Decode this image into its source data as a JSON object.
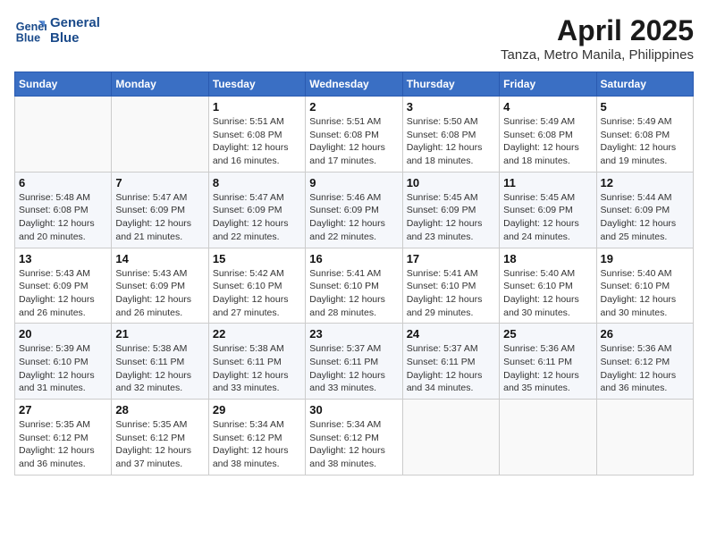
{
  "header": {
    "logo_line1": "General",
    "logo_line2": "Blue",
    "month_title": "April 2025",
    "location": "Tanza, Metro Manila, Philippines"
  },
  "weekdays": [
    "Sunday",
    "Monday",
    "Tuesday",
    "Wednesday",
    "Thursday",
    "Friday",
    "Saturday"
  ],
  "weeks": [
    [
      {
        "day": "",
        "sunrise": "",
        "sunset": "",
        "daylight": ""
      },
      {
        "day": "",
        "sunrise": "",
        "sunset": "",
        "daylight": ""
      },
      {
        "day": "1",
        "sunrise": "Sunrise: 5:51 AM",
        "sunset": "Sunset: 6:08 PM",
        "daylight": "Daylight: 12 hours and 16 minutes."
      },
      {
        "day": "2",
        "sunrise": "Sunrise: 5:51 AM",
        "sunset": "Sunset: 6:08 PM",
        "daylight": "Daylight: 12 hours and 17 minutes."
      },
      {
        "day": "3",
        "sunrise": "Sunrise: 5:50 AM",
        "sunset": "Sunset: 6:08 PM",
        "daylight": "Daylight: 12 hours and 18 minutes."
      },
      {
        "day": "4",
        "sunrise": "Sunrise: 5:49 AM",
        "sunset": "Sunset: 6:08 PM",
        "daylight": "Daylight: 12 hours and 18 minutes."
      },
      {
        "day": "5",
        "sunrise": "Sunrise: 5:49 AM",
        "sunset": "Sunset: 6:08 PM",
        "daylight": "Daylight: 12 hours and 19 minutes."
      }
    ],
    [
      {
        "day": "6",
        "sunrise": "Sunrise: 5:48 AM",
        "sunset": "Sunset: 6:08 PM",
        "daylight": "Daylight: 12 hours and 20 minutes."
      },
      {
        "day": "7",
        "sunrise": "Sunrise: 5:47 AM",
        "sunset": "Sunset: 6:09 PM",
        "daylight": "Daylight: 12 hours and 21 minutes."
      },
      {
        "day": "8",
        "sunrise": "Sunrise: 5:47 AM",
        "sunset": "Sunset: 6:09 PM",
        "daylight": "Daylight: 12 hours and 22 minutes."
      },
      {
        "day": "9",
        "sunrise": "Sunrise: 5:46 AM",
        "sunset": "Sunset: 6:09 PM",
        "daylight": "Daylight: 12 hours and 22 minutes."
      },
      {
        "day": "10",
        "sunrise": "Sunrise: 5:45 AM",
        "sunset": "Sunset: 6:09 PM",
        "daylight": "Daylight: 12 hours and 23 minutes."
      },
      {
        "day": "11",
        "sunrise": "Sunrise: 5:45 AM",
        "sunset": "Sunset: 6:09 PM",
        "daylight": "Daylight: 12 hours and 24 minutes."
      },
      {
        "day": "12",
        "sunrise": "Sunrise: 5:44 AM",
        "sunset": "Sunset: 6:09 PM",
        "daylight": "Daylight: 12 hours and 25 minutes."
      }
    ],
    [
      {
        "day": "13",
        "sunrise": "Sunrise: 5:43 AM",
        "sunset": "Sunset: 6:09 PM",
        "daylight": "Daylight: 12 hours and 26 minutes."
      },
      {
        "day": "14",
        "sunrise": "Sunrise: 5:43 AM",
        "sunset": "Sunset: 6:09 PM",
        "daylight": "Daylight: 12 hours and 26 minutes."
      },
      {
        "day": "15",
        "sunrise": "Sunrise: 5:42 AM",
        "sunset": "Sunset: 6:10 PM",
        "daylight": "Daylight: 12 hours and 27 minutes."
      },
      {
        "day": "16",
        "sunrise": "Sunrise: 5:41 AM",
        "sunset": "Sunset: 6:10 PM",
        "daylight": "Daylight: 12 hours and 28 minutes."
      },
      {
        "day": "17",
        "sunrise": "Sunrise: 5:41 AM",
        "sunset": "Sunset: 6:10 PM",
        "daylight": "Daylight: 12 hours and 29 minutes."
      },
      {
        "day": "18",
        "sunrise": "Sunrise: 5:40 AM",
        "sunset": "Sunset: 6:10 PM",
        "daylight": "Daylight: 12 hours and 30 minutes."
      },
      {
        "day": "19",
        "sunrise": "Sunrise: 5:40 AM",
        "sunset": "Sunset: 6:10 PM",
        "daylight": "Daylight: 12 hours and 30 minutes."
      }
    ],
    [
      {
        "day": "20",
        "sunrise": "Sunrise: 5:39 AM",
        "sunset": "Sunset: 6:10 PM",
        "daylight": "Daylight: 12 hours and 31 minutes."
      },
      {
        "day": "21",
        "sunrise": "Sunrise: 5:38 AM",
        "sunset": "Sunset: 6:11 PM",
        "daylight": "Daylight: 12 hours and 32 minutes."
      },
      {
        "day": "22",
        "sunrise": "Sunrise: 5:38 AM",
        "sunset": "Sunset: 6:11 PM",
        "daylight": "Daylight: 12 hours and 33 minutes."
      },
      {
        "day": "23",
        "sunrise": "Sunrise: 5:37 AM",
        "sunset": "Sunset: 6:11 PM",
        "daylight": "Daylight: 12 hours and 33 minutes."
      },
      {
        "day": "24",
        "sunrise": "Sunrise: 5:37 AM",
        "sunset": "Sunset: 6:11 PM",
        "daylight": "Daylight: 12 hours and 34 minutes."
      },
      {
        "day": "25",
        "sunrise": "Sunrise: 5:36 AM",
        "sunset": "Sunset: 6:11 PM",
        "daylight": "Daylight: 12 hours and 35 minutes."
      },
      {
        "day": "26",
        "sunrise": "Sunrise: 5:36 AM",
        "sunset": "Sunset: 6:12 PM",
        "daylight": "Daylight: 12 hours and 36 minutes."
      }
    ],
    [
      {
        "day": "27",
        "sunrise": "Sunrise: 5:35 AM",
        "sunset": "Sunset: 6:12 PM",
        "daylight": "Daylight: 12 hours and 36 minutes."
      },
      {
        "day": "28",
        "sunrise": "Sunrise: 5:35 AM",
        "sunset": "Sunset: 6:12 PM",
        "daylight": "Daylight: 12 hours and 37 minutes."
      },
      {
        "day": "29",
        "sunrise": "Sunrise: 5:34 AM",
        "sunset": "Sunset: 6:12 PM",
        "daylight": "Daylight: 12 hours and 38 minutes."
      },
      {
        "day": "30",
        "sunrise": "Sunrise: 5:34 AM",
        "sunset": "Sunset: 6:12 PM",
        "daylight": "Daylight: 12 hours and 38 minutes."
      },
      {
        "day": "",
        "sunrise": "",
        "sunset": "",
        "daylight": ""
      },
      {
        "day": "",
        "sunrise": "",
        "sunset": "",
        "daylight": ""
      },
      {
        "day": "",
        "sunrise": "",
        "sunset": "",
        "daylight": ""
      }
    ]
  ]
}
